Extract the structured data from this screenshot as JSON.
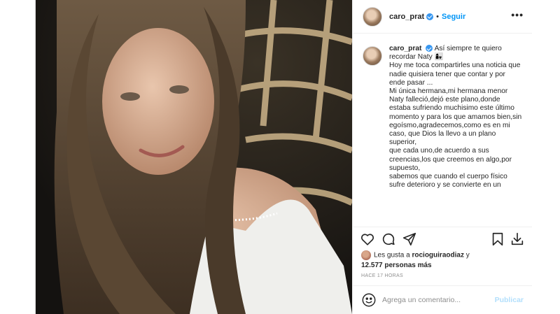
{
  "post": {
    "username": "caro_prat",
    "follow_label": "Seguir",
    "more_label": "•••",
    "caption": "Así siempre te quiero recordar Naty 👩‍👧\nHoy me toca compartirles una noticia que nadie quisiera tener que contar y por ende pasar ...\nMi única hermana,mi hermana menor Naty falleció,dejó este plano,donde estaba sufriendo muchisimo este último momento y para los que amamos bien,sin egoísmo,agradecemos,como es en mi caso, que Dios la llevo a un plano superior,\nque cada uno,de acuerdo a sus creencias,los que creemos en algo,por supuesto,\nsabemos que cuando el cuerpo físico sufre deterioro y se convierte en un"
  },
  "likes": {
    "prefix": "Les gusta a ",
    "first_liker": "rocioguiraodiaz",
    "connector": " y",
    "others": "12.577 personas más"
  },
  "timestamp": "HACE 17 HORAS",
  "comment_box": {
    "placeholder": "Agrega un comentario...",
    "publish_label": "Publicar"
  },
  "icons": {
    "like": "heart-icon",
    "comment": "comment-icon",
    "share": "share-icon",
    "save": "bookmark-icon",
    "download": "download-icon",
    "emoji": "emoji-icon",
    "verified": "verified-icon"
  },
  "colors": {
    "accent": "#0095f6",
    "verified": "#3897f0",
    "publish_disabled": "#b2dffc",
    "muted": "#8e8e8e"
  }
}
